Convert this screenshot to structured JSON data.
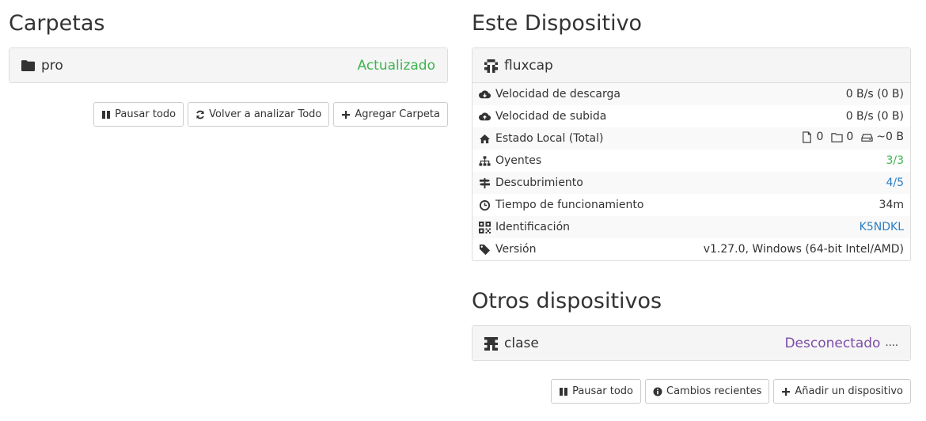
{
  "folders": {
    "heading": "Carpetas",
    "items": [
      {
        "name": "pro",
        "status": "Actualizado"
      }
    ],
    "buttons": {
      "pause_all": "Pausar todo",
      "rescan_all": "Volver a analizar Todo",
      "add_folder": "Agregar Carpeta"
    }
  },
  "this_device": {
    "heading": "Este Dispositivo",
    "name": "fluxcap",
    "rows": {
      "download_label": "Velocidad de descarga",
      "download_value": "0 B/s (0 B)",
      "upload_label": "Velocidad de subida",
      "upload_value": "0 B/s (0 B)",
      "local_label": "Estado Local (Total)",
      "local_files": "0",
      "local_dirs": "0",
      "local_size": "~0 B",
      "listeners_label": "Oyentes",
      "listeners_value": "3/3",
      "discovery_label": "Descubrimiento",
      "discovery_value": "4/5",
      "uptime_label": "Tiempo de funcionamiento",
      "uptime_value": "34m",
      "id_label": "Identificación",
      "id_value": "K5NDKL",
      "version_label": "Versión",
      "version_value": "v1.27.0, Windows (64-bit Intel/AMD)"
    }
  },
  "other_devices": {
    "heading": "Otros dispositivos",
    "items": [
      {
        "name": "clase",
        "status": "Desconectado",
        "dots": "...."
      }
    ],
    "buttons": {
      "pause_all": "Pausar todo",
      "recent_changes": "Cambios recientes",
      "add_device": "Añadir un dispositivo"
    }
  },
  "colors": {
    "ok": "#3fb34f",
    "disconnected": "#7d4da8",
    "link": "#2a7ec4"
  }
}
